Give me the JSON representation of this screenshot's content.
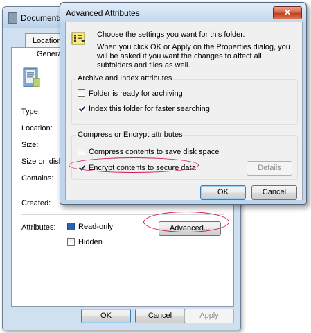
{
  "properties": {
    "title": "Documents",
    "tabs": [
      "Location",
      "Genera"
    ],
    "labels": {
      "type": "Type:",
      "location": "Location:",
      "size": "Size:",
      "size_on_disk": "Size on disk:",
      "contains": "Contains:",
      "created": "Created:",
      "attributes": "Attributes:"
    },
    "attributes": {
      "read_only": "Read-only",
      "hidden": "Hidden"
    },
    "advanced_button": "Advanced...",
    "buttons": {
      "ok": "OK",
      "cancel": "Cancel",
      "apply": "Apply"
    }
  },
  "advanced": {
    "title": "Advanced Attributes",
    "close_glyph": "✕",
    "intro": "Choose the settings you want for this folder.",
    "note": "When you click OK or Apply on the Properties dialog, you will be asked if you want the changes to affect all subfolders and files as well.",
    "archive_group": {
      "title": "Archive and Index attributes",
      "folder_ready": "Folder is ready for archiving",
      "index": "Index this folder for faster searching"
    },
    "compress_group": {
      "title": "Compress or Encrypt attributes",
      "compress": "Compress contents to save disk space",
      "encrypt": "Encrypt contents to secure data",
      "details": "Details"
    },
    "buttons": {
      "ok": "OK",
      "cancel": "Cancel"
    }
  },
  "colors": {
    "highlight": "#d1185f",
    "window_frame": "#bfd5ec"
  }
}
